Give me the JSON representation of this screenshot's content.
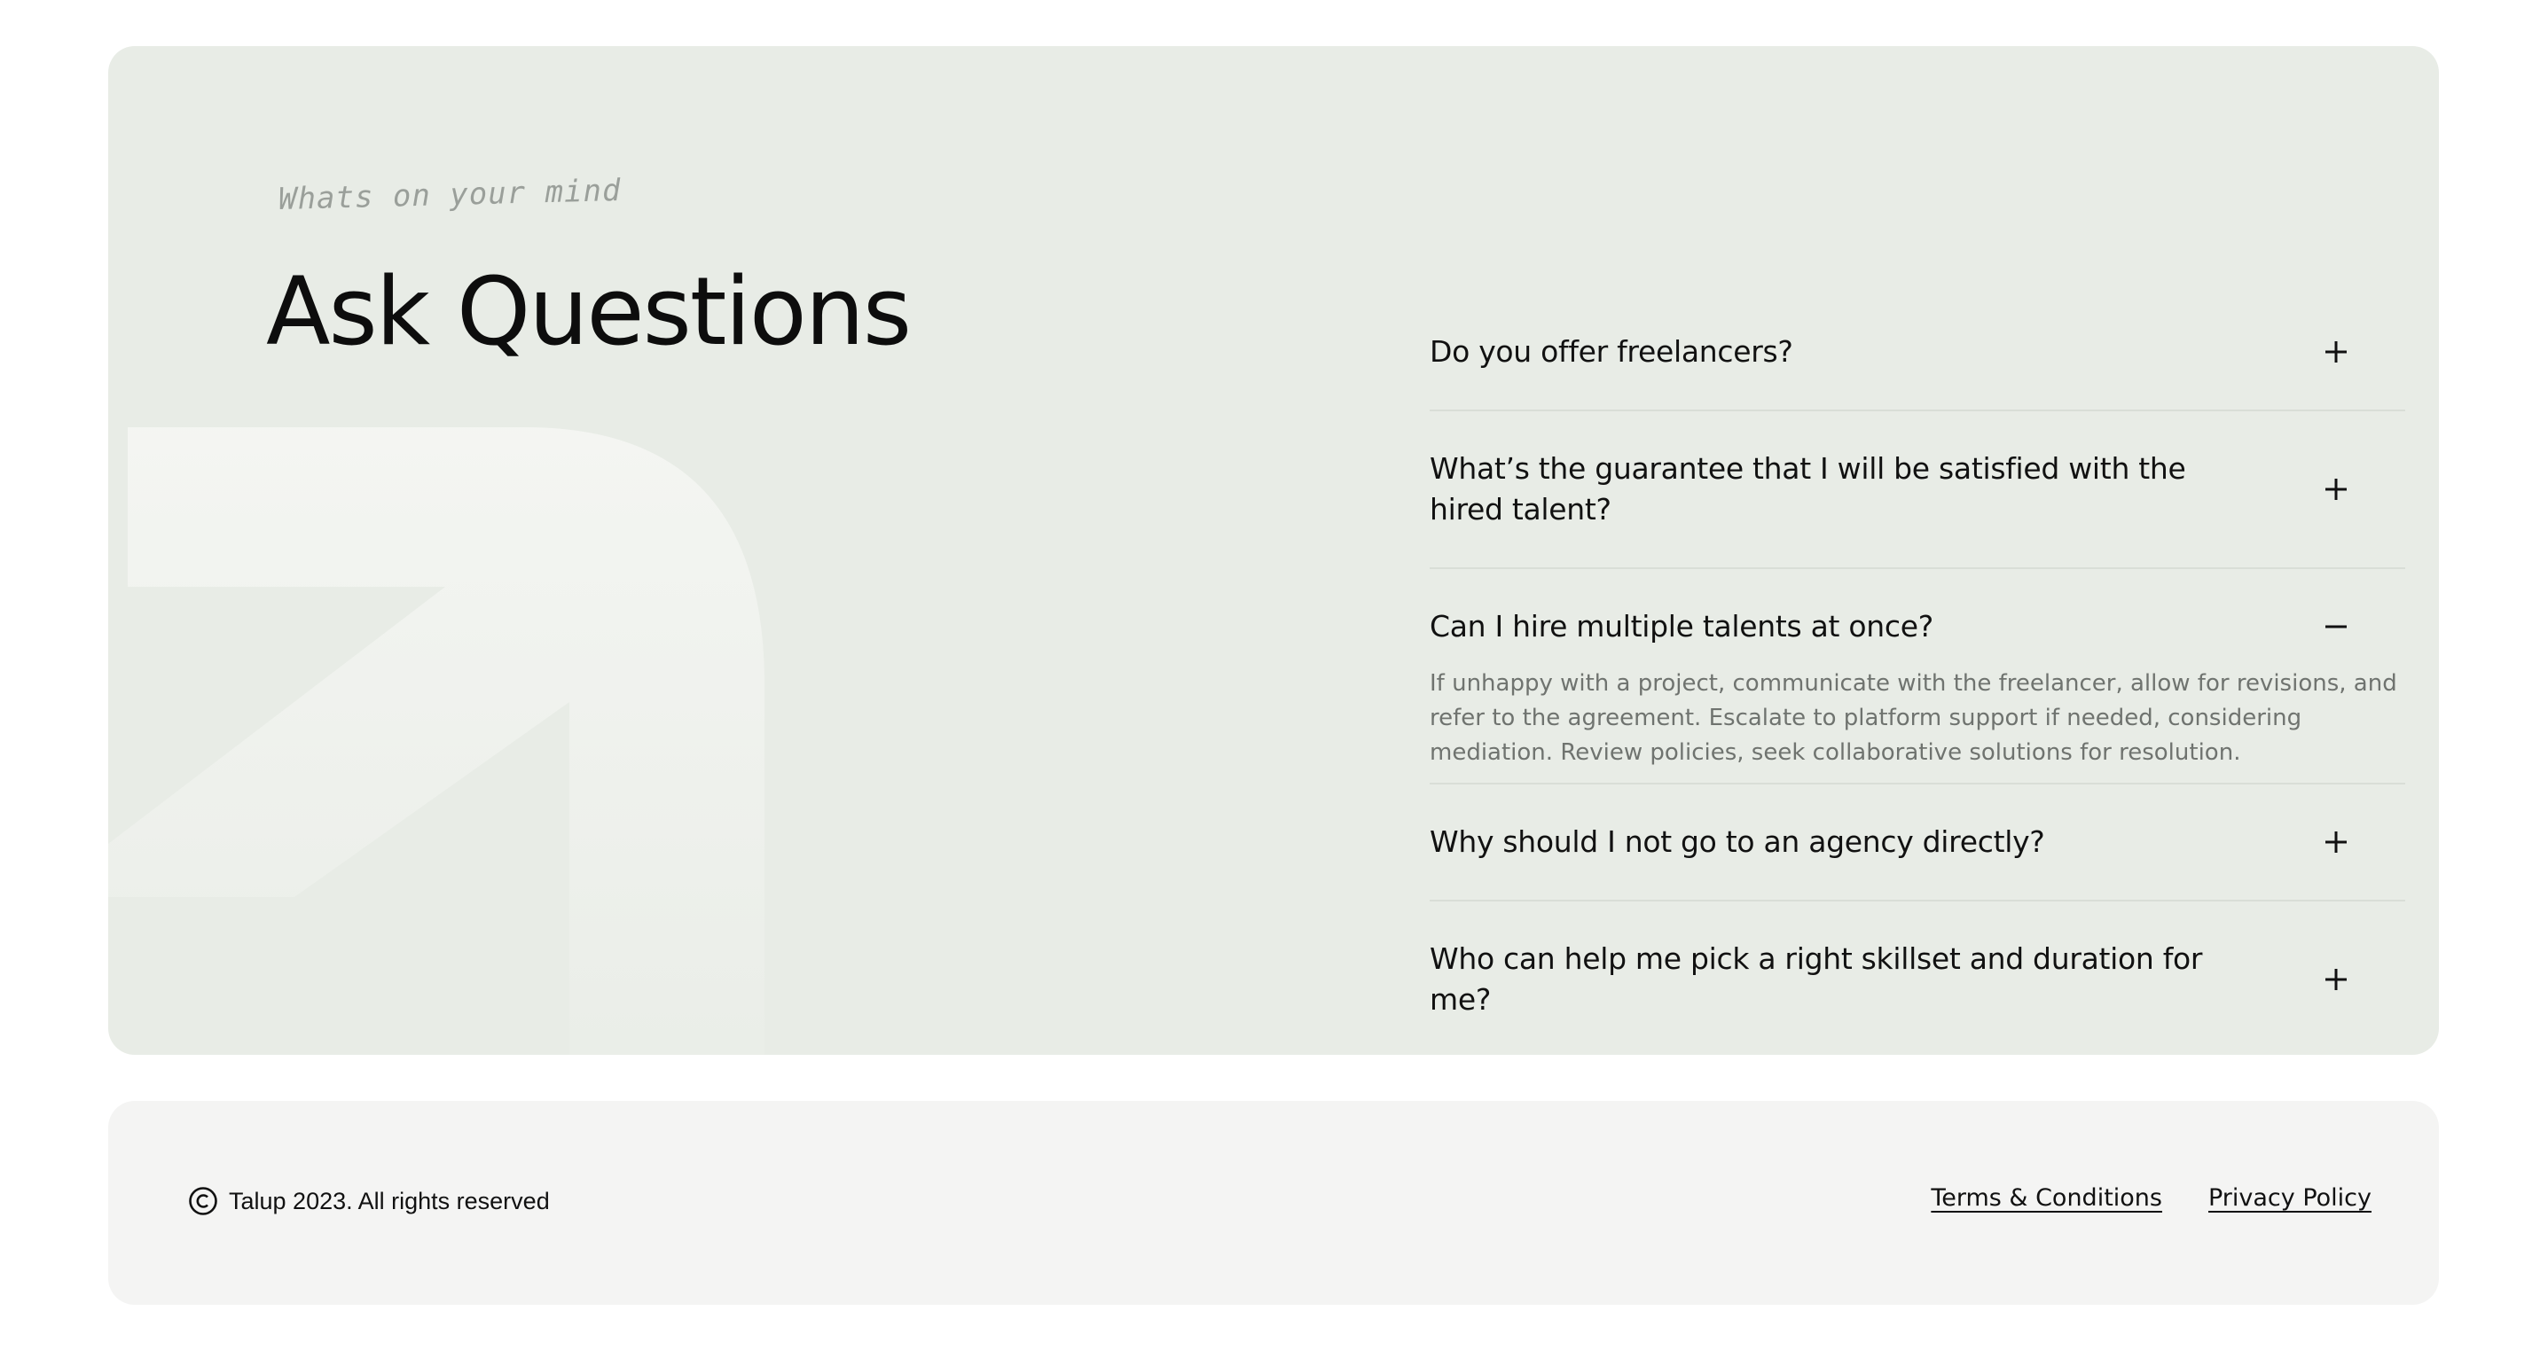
{
  "faq": {
    "eyebrow": "Whats on your mind",
    "title": "Ask Questions",
    "items": [
      {
        "question": "Do you offer freelancers?",
        "open": false,
        "answer": ""
      },
      {
        "question": "What’s the guarantee that I will be satisfied with the hired talent?",
        "open": false,
        "answer": ""
      },
      {
        "question": "Can I hire multiple talents at once?",
        "open": true,
        "answer": "If unhappy with a project, communicate with the freelancer, allow for revisions, and refer to the agreement. Escalate to platform support if needed, considering mediation. Review policies, seek collaborative solutions for resolution."
      },
      {
        "question": "Why should I not go to an agency directly?",
        "open": false,
        "answer": ""
      },
      {
        "question": "Who can help me pick a right skillset and duration for me?",
        "open": false,
        "answer": ""
      }
    ],
    "icons": {
      "collapsed": "plus-icon",
      "expanded": "minus-icon"
    }
  },
  "footer": {
    "copyright_icon": "copyright-icon",
    "copyright_text": "Talup 2023. All rights reserved",
    "links": {
      "terms": "Terms & Conditions",
      "privacy": "Privacy Policy"
    }
  },
  "colors": {
    "faq_background": "#e8ece6",
    "footer_background": "#f4f4f3",
    "text": "#111111",
    "muted_text": "#6f736f",
    "divider": "#d9ded7"
  }
}
